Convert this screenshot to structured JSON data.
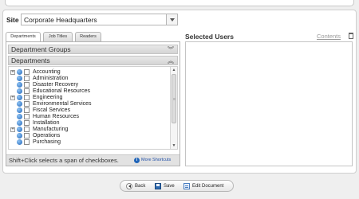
{
  "site": {
    "label": "Site",
    "value": "Corporate Headquarters"
  },
  "tabs": [
    {
      "label": "Departments",
      "active": true
    },
    {
      "label": "Job Titles",
      "active": false
    },
    {
      "label": "Readers",
      "active": false
    }
  ],
  "groups_bar": {
    "label": "Department Groups",
    "chevron": "double-chevron-down-icon"
  },
  "departments_bar": {
    "label": "Departments",
    "chevron": "double-chevron-up-icon"
  },
  "departments": [
    {
      "name": "Accounting",
      "expandable": true
    },
    {
      "name": "Administration",
      "expandable": false
    },
    {
      "name": "Disaster Recovery",
      "expandable": false
    },
    {
      "name": "Educational Resources",
      "expandable": false
    },
    {
      "name": "Engineering",
      "expandable": true
    },
    {
      "name": "Environmental Services",
      "expandable": false
    },
    {
      "name": "Fiscal Services",
      "expandable": false
    },
    {
      "name": "Human Resources",
      "expandable": false
    },
    {
      "name": "Installation",
      "expandable": false
    },
    {
      "name": "Manufacturing",
      "expandable": true
    },
    {
      "name": "Operations",
      "expandable": false
    },
    {
      "name": "Purchasing",
      "expandable": false
    }
  ],
  "tip": {
    "text": "Shift+Click selects a span of checkboxes.",
    "link": "More Shortcuts"
  },
  "selected_users": {
    "title": "Selected Users",
    "contents_link": "Contents"
  },
  "actions": {
    "back": "Back",
    "save": "Save",
    "edit": "Edit Document"
  },
  "colors": {
    "accent": "#1f64b8",
    "link": "#1f4fa8",
    "background": "#efefef"
  }
}
